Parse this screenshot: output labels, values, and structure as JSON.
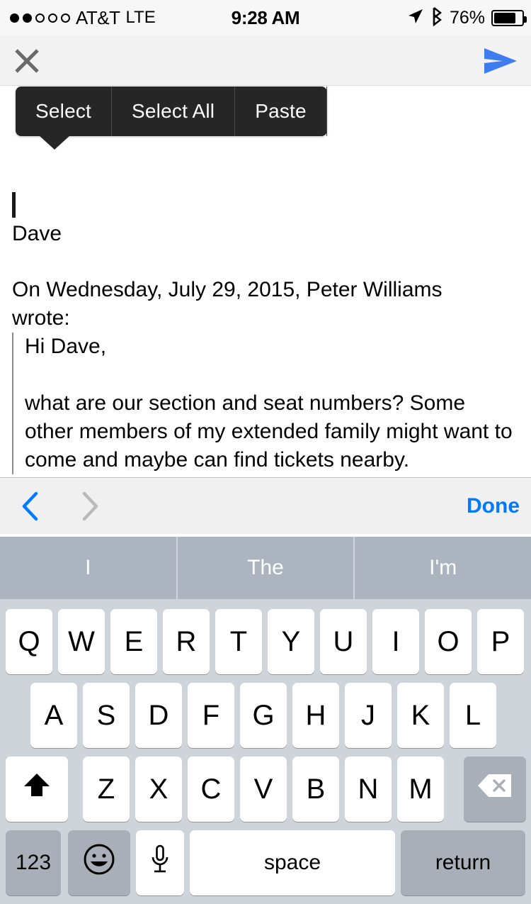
{
  "status_bar": {
    "signal_dots_filled": 2,
    "signal_dots_total": 5,
    "carrier": "AT&T",
    "network": "LTE",
    "time": "9:28 AM",
    "battery_percent": "76%",
    "battery_level": 76,
    "icons": [
      "location-arrow-icon",
      "bluetooth-icon",
      "battery-icon"
    ]
  },
  "compose_toolbar": {
    "close_icon": "close-x-icon",
    "send_icon": "send-arrow-icon",
    "send_color": "#3f7cf0"
  },
  "edit_menu": {
    "items": [
      {
        "label": "Select"
      },
      {
        "label": "Select All"
      },
      {
        "label": "Paste"
      }
    ],
    "background": "#262626",
    "text_color": "#ffffff"
  },
  "message": {
    "signature": "Dave",
    "attribution": "On Wednesday, July 29, 2015, Peter Williams wrote:",
    "quote": [
      "Hi Dave,",
      "what are our section and seat numbers? Some other members of my extended family might want to come and maybe can find tickets nearby."
    ]
  },
  "keyboard_accessory": {
    "prev_icon": "chevron-left-icon",
    "next_icon": "chevron-right-icon",
    "prev_enabled": true,
    "next_enabled": false,
    "done_label": "Done",
    "done_color": "#027aff"
  },
  "predictive": {
    "suggestions": [
      "I",
      "The",
      "I'm"
    ],
    "background": "#acb4bf",
    "text_color": "#ffffff"
  },
  "keyboard": {
    "row1": [
      "Q",
      "W",
      "E",
      "R",
      "T",
      "Y",
      "U",
      "I",
      "O",
      "P"
    ],
    "row2": [
      "A",
      "S",
      "D",
      "F",
      "G",
      "H",
      "J",
      "K",
      "L"
    ],
    "row3": [
      "Z",
      "X",
      "C",
      "V",
      "B",
      "N",
      "M"
    ],
    "shift_icon": "shift-up-arrow-icon",
    "delete_icon": "backspace-delete-icon",
    "numbers_label": "123",
    "emoji_icon": "emoji-smiley-icon",
    "dictation_icon": "microphone-icon",
    "space_label": "space",
    "return_label": "return",
    "background": "#cfd3da",
    "key_background": "#ffffff",
    "modifier_background": "#a9afb9"
  }
}
